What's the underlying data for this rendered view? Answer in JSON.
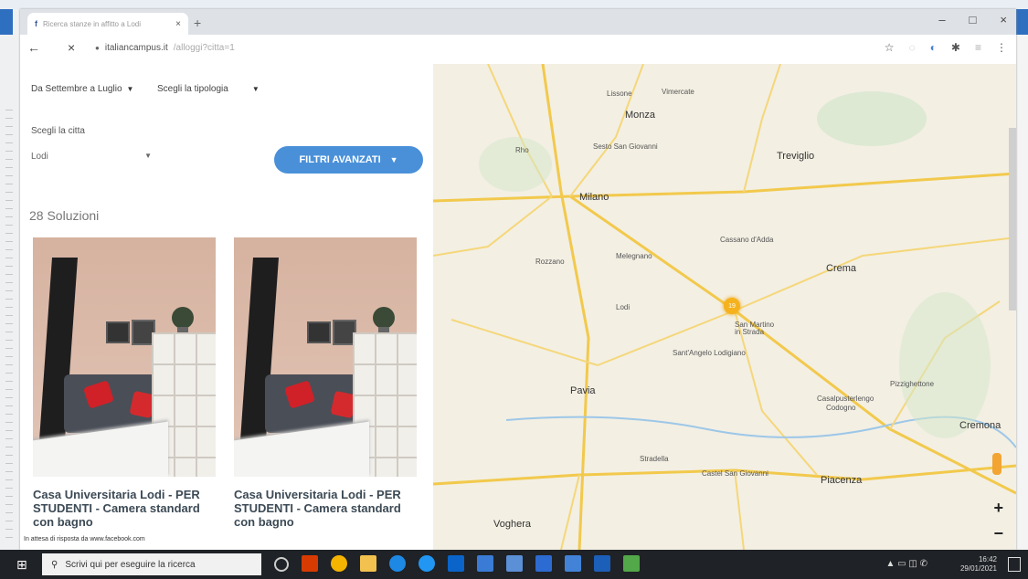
{
  "browser": {
    "tab_title": "Ricerca stanze in affitto a Lodi",
    "tab_close": "×",
    "new_tab": "+",
    "url": "italiancampus.it",
    "url_rest": "/alloggi?citta=1",
    "window_controls": [
      "–",
      "□",
      "×"
    ],
    "back_icon": "←",
    "stop_icon": "×"
  },
  "filters": {
    "period": "Da Settembre a Luglio",
    "typology": "Scegli la tipologia",
    "city_label": "Scegli la citta",
    "city_value": "Lodi",
    "advanced_button": "FILTRI AVANZATI"
  },
  "results": {
    "count": "28 Soluzioni",
    "cards": [
      {
        "title": "Casa Universitaria Lodi - PER STUDENTI - Camera standard con bagno"
      },
      {
        "title": "Casa Universitaria Lodi - PER STUDENTI - Camera standard con bagno"
      }
    ]
  },
  "status_bar": "In attesa di risposta da www.facebook.com",
  "map": {
    "labels": {
      "monza": "Monza",
      "milano": "Milano",
      "treviglio": "Treviglio",
      "crema": "Crema",
      "pavia": "Pavia",
      "piacenza": "Piacenza",
      "cremona": "Cremona",
      "voghera": "Voghera",
      "lissone": "Lissone",
      "vimercate": "Vimercate",
      "rho": "Rho",
      "sesto": "Sesto San Giovanni",
      "sanmartino": "San Martino in Strada",
      "cassano": "Cassano d'Adda",
      "lodi": "Lodi",
      "sanangelo": "Sant'Angelo Lodigiano",
      "codogno": "Codogno",
      "casalpusterlengo": "Casalpusterlengo",
      "stradella": "Stradella",
      "pizzighettone": "Pizzighettone",
      "castelsangiovanni": "Castel San Giovanni",
      "melegnano": "Melegnano",
      "rozzano": "Rozzano"
    },
    "marker_label": "19",
    "zoom_in": "+",
    "zoom_out": "−"
  },
  "taskbar": {
    "search_placeholder": "Scrivi qui per eseguire la ricerca",
    "time": "16:42",
    "date": "29/01/2021"
  },
  "colors": {
    "accent": "#4a90d9",
    "marker": "#f5b21d",
    "taskbar": "#1f2226"
  }
}
